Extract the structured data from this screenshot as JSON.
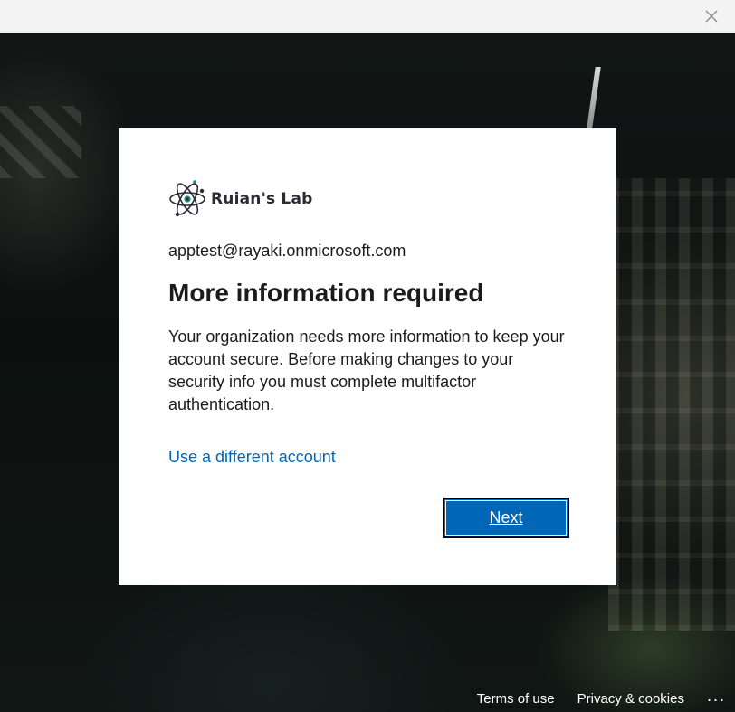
{
  "window": {
    "close_icon": "close-icon"
  },
  "card": {
    "logo": {
      "icon": "atom-logo-icon",
      "text": "Ruian's Lab"
    },
    "email": "apptest@rayaki.onmicrosoft.com",
    "heading": "More information required",
    "description": "Your organization needs more information to keep your account secure. Before making changes to your security info you must complete multifactor authentication.",
    "different_account_link": "Use a different account",
    "next_button": "Next"
  },
  "footer": {
    "terms": "Terms of use",
    "privacy": "Privacy & cookies",
    "more": "..."
  },
  "colors": {
    "accent": "#0067b8",
    "card_bg": "#ffffff",
    "titlebar_bg": "#f3f3f3",
    "text": "#1b1b1b"
  }
}
